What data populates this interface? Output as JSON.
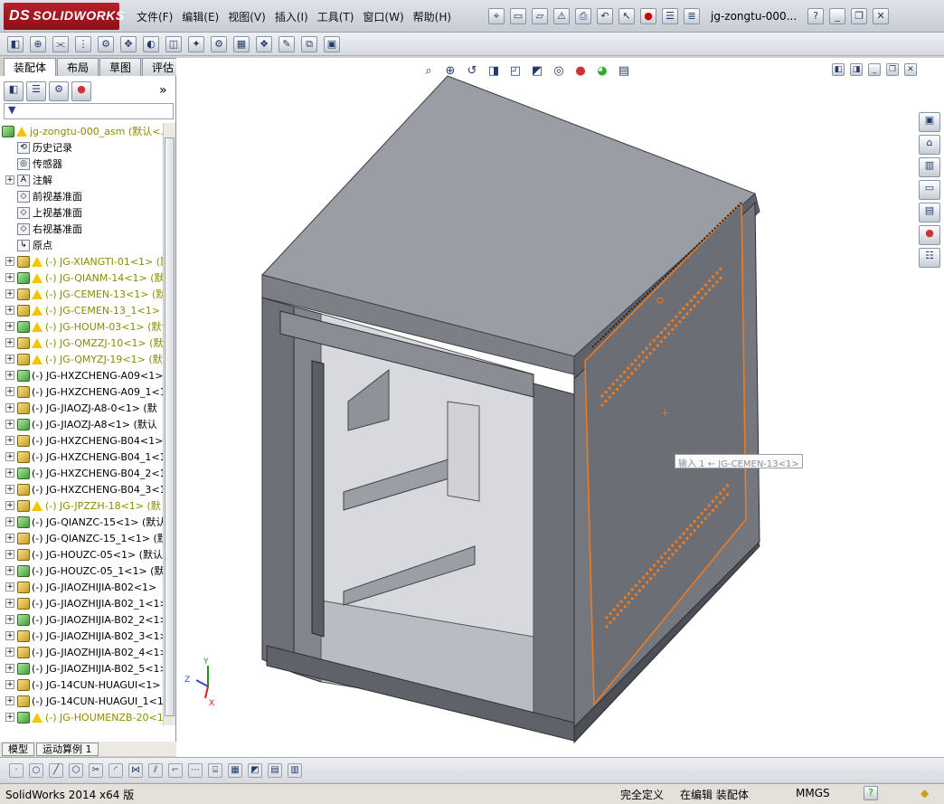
{
  "app": {
    "logo_text": "SOLIDWORKS",
    "logo_prefix": "DS",
    "doc_title": "jg-zongtu-000..."
  },
  "menu": [
    "文件(F)",
    "编辑(E)",
    "视图(V)",
    "插入(I)",
    "工具(T)",
    "窗口(W)",
    "帮助(H)"
  ],
  "top_icons": [
    "pin-icon",
    "new-icon",
    "open-icon",
    "rebuild-icon",
    "print-icon",
    "undo-icon",
    "select-icon",
    "traffic-light-icon",
    "options-icon",
    "properties-icon"
  ],
  "help_label": "?",
  "cmd_icons": [
    "assembly-icon",
    "insert-icon",
    "mate-icon",
    "linear-pattern-icon",
    "smart-fastener-icon",
    "move-icon",
    "show-hidden-icon",
    "assembly-features-icon",
    "reference-geometry-icon",
    "new-motion-icon",
    "bill-icon",
    "exploded-view-icon",
    "sketch-line-icon",
    "interference-icon",
    "instant3d-icon"
  ],
  "tabs": [
    "装配体",
    "布局",
    "草图",
    "评估"
  ],
  "fm_tabs": [
    "featuremanager-icon",
    "propertymanager-icon",
    "configurationmanager-icon",
    "displaymanager-icon"
  ],
  "fm_expand": "»",
  "filter_placeholder": "",
  "tree": {
    "root": "jg-zongtu-000_asm  (默认<.",
    "fixed": [
      "历史记录",
      "传感器",
      "注解",
      "前视基准面",
      "上视基准面",
      "右视基准面",
      "原点"
    ],
    "parts": [
      {
        "label": "(-) JG-XIANGTI-01<1> (默",
        "warn": true
      },
      {
        "label": "(-) JG-QIANM-14<1> (默",
        "warn": true
      },
      {
        "label": "(-) JG-CEMEN-13<1> (默",
        "warn": true
      },
      {
        "label": "(-) JG-CEMEN-13_1<1>",
        "warn": true
      },
      {
        "label": "(-) JG-HOUM-03<1> (默认",
        "warn": true
      },
      {
        "label": "(-) JG-QMZZJ-10<1> (默",
        "warn": true
      },
      {
        "label": "(-) JG-QMYZJ-19<1> (默",
        "warn": true
      },
      {
        "label": "(-) JG-HXZCHENG-A09<1> (",
        "warn": false
      },
      {
        "label": "(-) JG-HXZCHENG-A09_1<1>",
        "warn": false
      },
      {
        "label": "(-) JG-JIAOZJ-A8-0<1> (默",
        "warn": false
      },
      {
        "label": "(-) JG-JIAOZJ-A8<1> (默认",
        "warn": false
      },
      {
        "label": "(-) JG-HXZCHENG-B04<1> (",
        "warn": false
      },
      {
        "label": "(-) JG-HXZCHENG-B04_1<1>",
        "warn": false
      },
      {
        "label": "(-) JG-HXZCHENG-B04_2<1>",
        "warn": false
      },
      {
        "label": "(-) JG-HXZCHENG-B04_3<1>",
        "warn": false
      },
      {
        "label": "(-) JG-JPZZH-18<1> (默",
        "warn": true
      },
      {
        "label": "(-) JG-QIANZC-15<1> (默认",
        "warn": false
      },
      {
        "label": "(-) JG-QIANZC-15_1<1> (默",
        "warn": false
      },
      {
        "label": "(-) JG-HOUZC-05<1> (默认",
        "warn": false
      },
      {
        "label": "(-) JG-HOUZC-05_1<1> (默",
        "warn": false
      },
      {
        "label": "(-) JG-JIAOZHIJIA-B02<1>",
        "warn": false
      },
      {
        "label": "(-) JG-JIAOZHIJIA-B02_1<1>",
        "warn": false
      },
      {
        "label": "(-) JG-JIAOZHIJIA-B02_2<1>",
        "warn": false
      },
      {
        "label": "(-) JG-JIAOZHIJIA-B02_3<1>",
        "warn": false
      },
      {
        "label": "(-) JG-JIAOZHIJIA-B02_4<1>",
        "warn": false
      },
      {
        "label": "(-) JG-JIAOZHIJIA-B02_5<1>",
        "warn": false
      },
      {
        "label": "(-) JG-14CUN-HUAGUI<1> (",
        "warn": false
      },
      {
        "label": "(-) JG-14CUN-HUAGUI_1<1>",
        "warn": false
      },
      {
        "label": "(-) JG-HOUMENZB-20<1> (",
        "warn": true
      }
    ]
  },
  "bottom_tabs": [
    "模型",
    "运动算例 1"
  ],
  "tooltip": "输入 1 ← JG-CEMEN-13<1>",
  "view_icons": [
    "zoom-fit-icon",
    "zoom-area-icon",
    "previous-view-icon",
    "section-view-icon",
    "view-orientation-icon",
    "display-style-icon",
    "hide-show-icon",
    "edit-appearance-icon",
    "apply-scene-icon",
    "view-settings-icon"
  ],
  "task_pane": [
    "solidworks-resources-icon",
    "home-icon",
    "design-library-icon",
    "file-explorer-icon",
    "view-palette-icon",
    "appearances-icon",
    "custom-properties-icon"
  ],
  "triad": {
    "x": "X",
    "y": "Y",
    "z": "Z"
  },
  "sketch_tools": [
    "point-icon",
    "circle-icon",
    "line-icon",
    "polygon-icon",
    "trim-icon",
    "arc-icon",
    "mirror-icon",
    "offset-icon",
    "corner-icon",
    "construction-icon",
    "dimension-icon",
    "grid-icon",
    "part-icon",
    "table-icon",
    "table2-icon"
  ],
  "status": {
    "app": "SolidWorks 2014 x64 版",
    "defined": "完全定义",
    "editing": "在编辑 装配体",
    "units": "MMGS",
    "help": "?"
  },
  "colors": {
    "accent": "#f07a1e",
    "cabinet": "#8d9096",
    "cabinet_dark": "#676a70",
    "warn": "#f3c400"
  }
}
